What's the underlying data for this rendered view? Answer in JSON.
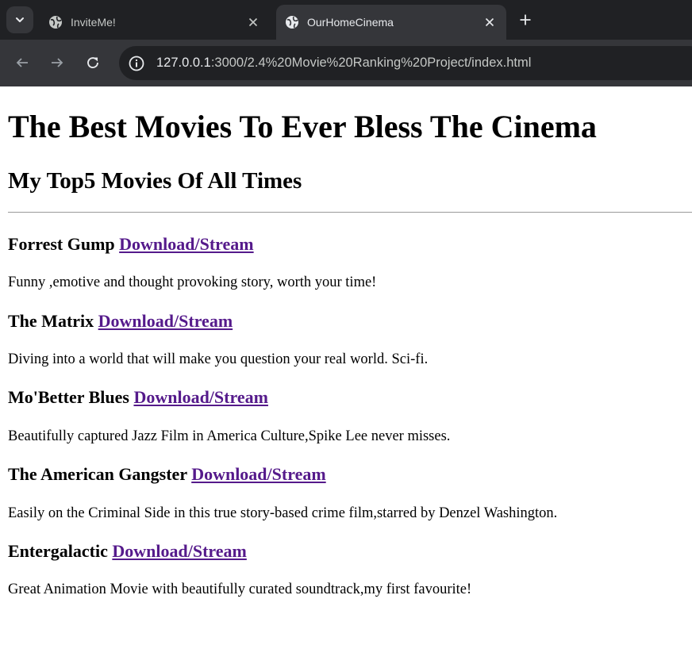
{
  "browser": {
    "tabs": [
      {
        "title": "InviteMe!",
        "active": false
      },
      {
        "title": "OurHomeCinema",
        "active": true
      }
    ],
    "url_host": "127.0.0.1",
    "url_rest": ":3000/2.4%20Movie%20Ranking%20Project/index.html"
  },
  "page": {
    "heading": "The Best Movies To Ever Bless The Cinema",
    "subheading": "My Top5 Movies Of All Times",
    "movies": [
      {
        "title": "Forrest Gump",
        "link": "Download/Stream",
        "description": "Funny ,emotive and thought provoking story, worth your time!"
      },
      {
        "title": "The Matrix",
        "link": "Download/Stream",
        "description": "Diving into a world that will make you question your real world. Sci-fi."
      },
      {
        "title": "Mo'Better Blues",
        "link": "Download/Stream",
        "description": "Beautifully captured Jazz Film in America Culture,Spike Lee never misses."
      },
      {
        "title": "The American Gangster",
        "link": "Download/Stream",
        "description": "Easily on the Criminal Side in this true story-based crime film,starred by Denzel Washington."
      },
      {
        "title": "Entergalactic",
        "link": "Download/Stream",
        "description": "Great Animation Movie with beautifully curated soundtrack,my first favourite!"
      }
    ]
  },
  "colors": {
    "visited_link": "#551a8b",
    "chrome_dark": "#202124",
    "chrome_mid": "#35363a"
  }
}
